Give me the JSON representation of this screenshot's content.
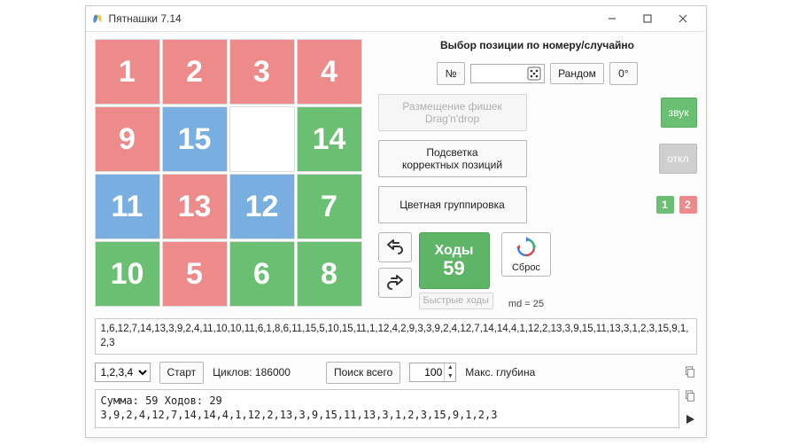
{
  "window": {
    "title": "Пятнашки 7.14"
  },
  "board": [
    {
      "v": "1",
      "c": "red"
    },
    {
      "v": "2",
      "c": "red"
    },
    {
      "v": "3",
      "c": "red"
    },
    {
      "v": "4",
      "c": "red"
    },
    {
      "v": "9",
      "c": "red"
    },
    {
      "v": "15",
      "c": "blue"
    },
    {
      "v": "",
      "c": "empty"
    },
    {
      "v": "14",
      "c": "green"
    },
    {
      "v": "11",
      "c": "blue"
    },
    {
      "v": "13",
      "c": "red"
    },
    {
      "v": "12",
      "c": "blue"
    },
    {
      "v": "7",
      "c": "green"
    },
    {
      "v": "10",
      "c": "green"
    },
    {
      "v": "5",
      "c": "red"
    },
    {
      "v": "6",
      "c": "green"
    },
    {
      "v": "8",
      "c": "green"
    }
  ],
  "side": {
    "heading": "Выбор позиции по номеру/случайно",
    "num_label": "№",
    "position_value": "",
    "random_label": "Рандом",
    "zero_label": "0°",
    "dragdrop_btn": "Размещение фишек\nDrag'n'drop",
    "sound_btn": "звук",
    "highlight_btn": "Подсветка\nкорректных позиций",
    "off_btn": "откл",
    "color_group_btn": "Цветная группировка",
    "badge1": "1",
    "badge2": "2",
    "moves_label": "Ходы",
    "moves_count": "59",
    "fast_moves_btn": "Быстрые ходы",
    "reset_label": "Сброс",
    "md_label": "md = 25"
  },
  "sequence": "1,6,12,7,14,13,3,9,2,4,11,10,10,11,6,1,8,6,11,15,5,10,15,11,1,12,4,2,9,3,3,9,2,4,12,7,14,14,4,1,12,2,13,3,9,15,11,13,3,1,2,3,15,9,1,2,3",
  "controls": {
    "order_select": "1,2,3,4",
    "start_btn": "Старт",
    "cycles_label": "Циклов: 186000",
    "search_btn": "Поиск всего",
    "depth_value": "100",
    "depth_label": "Макс. глубина"
  },
  "result": {
    "line1": "Сумма: 59 Ходов: 29",
    "line2": "3,9,2,4,12,7,14,14,4,1,12,2,13,3,9,15,11,13,3,1,2,3,15,9,1,2,3"
  }
}
